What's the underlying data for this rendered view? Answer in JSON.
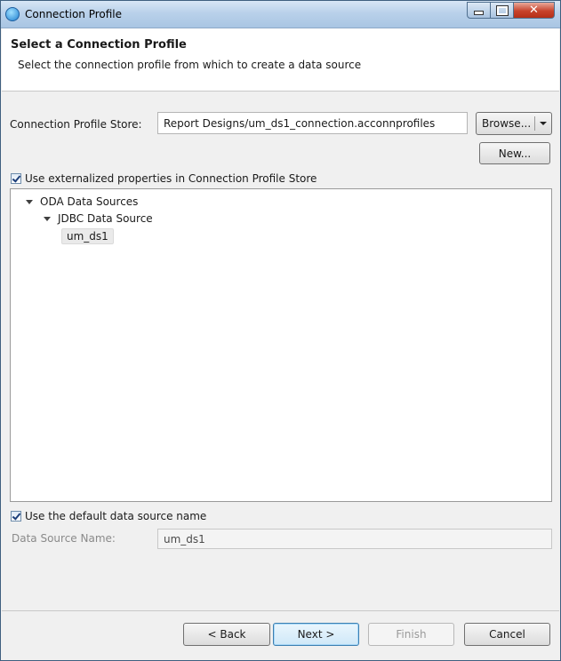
{
  "window": {
    "title": "Connection Profile"
  },
  "header": {
    "title": "Select a Connection Profile",
    "description": "Select the connection profile from which to create a data source"
  },
  "store": {
    "label": "Connection Profile Store:",
    "value": "Report Designs/um_ds1_connection.acconnprofiles",
    "browse_label": "Browse...",
    "new_label": "New..."
  },
  "externalize": {
    "label": "Use externalized properties in Connection Profile Store",
    "checked": true
  },
  "tree": {
    "root": "ODA Data Sources",
    "child": "JDBC Data Source",
    "leaf": "um_ds1"
  },
  "default_name": {
    "label": "Use the default data source name",
    "checked": true
  },
  "data_source": {
    "label": "Data Source Name:",
    "value": "um_ds1"
  },
  "buttons": {
    "back": "< Back",
    "next": "Next >",
    "finish": "Finish",
    "cancel": "Cancel"
  },
  "colors": {
    "titlebar": "#b9d1ea",
    "close_button": "#c7432c",
    "default_button_border": "#3c7fb1"
  }
}
